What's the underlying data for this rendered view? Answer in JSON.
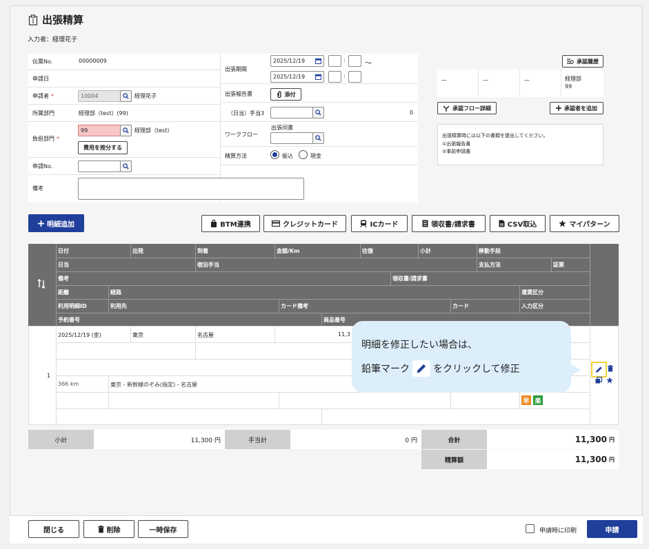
{
  "page": {
    "title": "出張精算",
    "inputter": "入力者：経理花子"
  },
  "left_form": {
    "slip_no_label": "伝票No.",
    "slip_no_value": "00000009",
    "apply_date_label": "申請日",
    "applicant_label": "申請者",
    "applicant_code": "10004",
    "applicant_name": "経理花子",
    "dept_label": "所属部門",
    "dept_value": "経理部（test）(99)",
    "burden_label": "負担部門",
    "burden_code": "99",
    "burden_name": "経理部（test）",
    "split_button": "費用を按分する",
    "apply_no_label": "申請No.",
    "note_label": "備考",
    "required_mark": "*"
  },
  "mid_form": {
    "period_label": "出張期間",
    "date_from": "2025/12/19",
    "date_to": "2025/12/19",
    "time_sep": ":",
    "tilde": "～",
    "report_label": "出張報告書",
    "attach_button": "添付",
    "allowance_label": "（日当）手当3",
    "allowance_value": "0",
    "workflow_label": "ワークフロー",
    "workflow_sub": "出張伺書",
    "settle_label": "精算方法",
    "settle_opt1": "振込",
    "settle_opt2": "現金"
  },
  "approval": {
    "history_button": "承認履歴",
    "col1": "—",
    "col2": "—",
    "col3": "—",
    "col4_line1": "経理部",
    "col4_line2": "99",
    "flow_detail_button": "承認フロー詳細",
    "add_approver_button": "承認者を追加",
    "notice_line1": "出張精算時には以下の書類を提出してください。",
    "notice_line2": "①出張報告書",
    "notice_line3": "②事前申請書"
  },
  "toolbar": {
    "add_detail": "明細追加",
    "btm": "BTM連携",
    "credit": "クレジットカード",
    "ic": "ICカード",
    "receipt": "領収書/請求書",
    "csv": "CSV取込",
    "pattern": "マイパターン"
  },
  "table_header": {
    "r1": [
      "日付",
      "出発",
      "到着",
      "金額/Km",
      "往復",
      "小計",
      "移動手段"
    ],
    "r2": [
      "日当",
      "宿泊手当",
      "支払方法",
      "証票"
    ],
    "r3": [
      "備考",
      "領収書/請求書"
    ],
    "r4": [
      "距離",
      "経路",
      "運賃区分"
    ],
    "r5": [
      "利用明細ID",
      "利用先",
      "カード備考",
      "カード",
      "入力区分"
    ],
    "r6": [
      "予約番号",
      "商品番号"
    ]
  },
  "row1": {
    "index": "1",
    "date": "2025/12/19 (金)",
    "from": "東京",
    "to": "名古屋",
    "amount": "11,3",
    "distance": "366 km",
    "route": "東京 - 新幹線のぞみ(指定) - 名古屋",
    "badge1": "早",
    "badge2": "楽",
    "badge1_color": "#f08a24",
    "badge2_color": "#2e9a3e"
  },
  "tooltip": {
    "line1": "明細を修正したい場合は、",
    "line2_pre": "鉛筆マーク",
    "line2_post": "をクリックして修正"
  },
  "totals": {
    "subtotal_label": "小計",
    "subtotal_value": "11,300 円",
    "allowance_label": "手当計",
    "allowance_value": "0 円",
    "total_label": "合計",
    "total_value": "11,300",
    "settle_label": "精算額",
    "settle_value": "11,300",
    "unit": "円"
  },
  "footer": {
    "close": "閉じる",
    "delete": "削除",
    "save": "一時保存",
    "print_label": "申請時に印刷",
    "apply": "申請"
  },
  "colors": {
    "accent": "#1f3f9b",
    "header_gray": "#6d6d6d",
    "highlight": "#f2d233"
  }
}
